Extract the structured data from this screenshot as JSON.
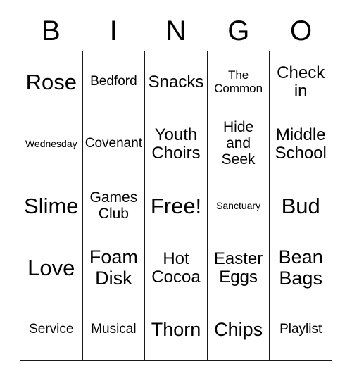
{
  "header": {
    "letters": [
      "B",
      "I",
      "N",
      "G",
      "O"
    ]
  },
  "colors": {
    "background": "#ffffff",
    "border": "#1a1a1a",
    "text": "#000000"
  },
  "grid": {
    "columns": 5,
    "rows": 5,
    "free_space_label": "Free!",
    "cells": [
      {
        "text": "Rose",
        "size": "fs-xxl"
      },
      {
        "text": "Bedford",
        "size": "fs-sm"
      },
      {
        "text": "Snacks",
        "size": "fs-lg"
      },
      {
        "text": "The\nCommon",
        "size": "fs-xs"
      },
      {
        "text": "Check\nin",
        "size": "fs-lg"
      },
      {
        "text": "Wednesday",
        "size": "fs-xxs"
      },
      {
        "text": "Covenant",
        "size": "fs-sm"
      },
      {
        "text": "Youth\nChoirs",
        "size": "fs-lg"
      },
      {
        "text": "Hide\nand\nSeek",
        "size": "fs-md"
      },
      {
        "text": "Middle\nSchool",
        "size": "fs-lg"
      },
      {
        "text": "Slime",
        "size": "fs-xxl"
      },
      {
        "text": "Games\nClub",
        "size": "fs-md"
      },
      {
        "text": "Free!",
        "size": "fs-xxl"
      },
      {
        "text": "Sanctuary",
        "size": "fs-xxs"
      },
      {
        "text": "Bud",
        "size": "fs-xxl"
      },
      {
        "text": "Love",
        "size": "fs-xxl"
      },
      {
        "text": "Foam\nDisk",
        "size": "fs-xl"
      },
      {
        "text": "Hot\nCocoa",
        "size": "fs-lg"
      },
      {
        "text": "Easter\nEggs",
        "size": "fs-lg"
      },
      {
        "text": "Bean\nBags",
        "size": "fs-xl"
      },
      {
        "text": "Service",
        "size": "fs-sm"
      },
      {
        "text": "Musical",
        "size": "fs-sm"
      },
      {
        "text": "Thorn",
        "size": "fs-xl"
      },
      {
        "text": "Chips",
        "size": "fs-xl"
      },
      {
        "text": "Playlist",
        "size": "fs-sm"
      }
    ]
  }
}
